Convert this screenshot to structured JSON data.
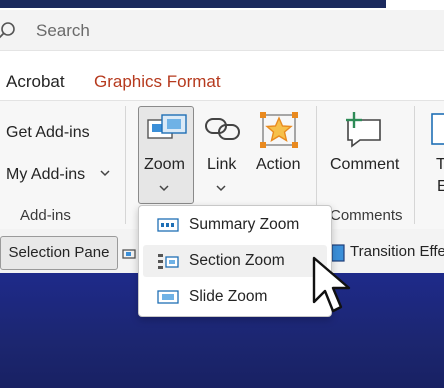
{
  "search": {
    "placeholder": "Search"
  },
  "tabs": [
    {
      "label": "Acrobat"
    },
    {
      "label": "Graphics Format"
    }
  ],
  "ribbon": {
    "addins": {
      "get_label": "Get Add-ins",
      "my_label": "My Add-ins",
      "group_label": "Add-ins"
    },
    "zoom": {
      "label": "Zoom"
    },
    "link": {
      "label": "Link"
    },
    "action": {
      "label": "Action"
    },
    "comment": {
      "label": "Comment",
      "group_label": "Comments"
    },
    "overflow": {
      "line1": "T",
      "line2": "E"
    }
  },
  "lower": {
    "selection_pane": "Selection Pane",
    "transition": "Transition Effe"
  },
  "zoom_menu": {
    "items": [
      {
        "label": "Summary Zoom"
      },
      {
        "label": "Section Zoom"
      },
      {
        "label": "Slide Zoom"
      }
    ]
  },
  "colors": {
    "accent_tab": "#b63a1e",
    "slide_bg": "#1e2a8a",
    "icon_blue": "#1f6fb5",
    "comment_green": "#2e8b57",
    "action_orange": "#e98a1f"
  }
}
